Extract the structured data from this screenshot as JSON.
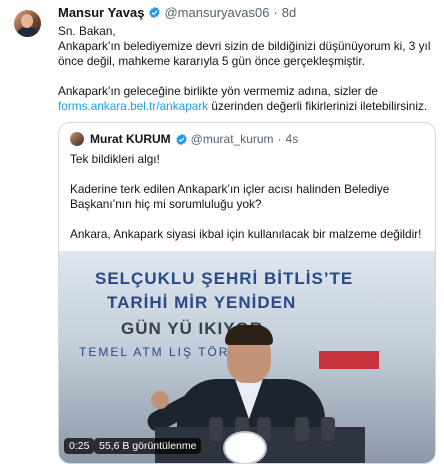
{
  "tweet": {
    "author_name": "Mansur Yavaş",
    "handle": "@mansuryavas06",
    "separator": "·",
    "time": "8d",
    "text": {
      "line1": "Sn. Bakan,",
      "line2": "Ankapark’ın belediyemize devri sizin de bildiğinizi düşünüyorum ki, 3 yıl önce değil, mahkeme kararıyla 5 gün önce gerçekleşmiştir.",
      "para2_before": "Ankapark’ın geleceğine birlikte yön vermemiz adına, sizler de ",
      "link": "forms.ankara.bel.tr/ankapark",
      "para2_after": " üzerinden değerli fikirlerinizi iletebilirsiniz."
    }
  },
  "quote": {
    "author_name": "Murat KURUM",
    "handle": "@murat_kurum",
    "separator": "·",
    "time": "4s",
    "text": {
      "line1": "Tek bildikleri algı!",
      "line2": "Kaderine terk edilen Ankapark’ın içler acısı halinden Belediye Başkanı’nın hiç mi sorumluluğu yok?",
      "line3": "Ankara, Ankapark siyasi ikbal için kullanılacak bir malzeme değildir!"
    },
    "video": {
      "duration": "0:25",
      "views": "55,6 B görüntülenme",
      "banner_line1": "SELÇUKLU ŞEHRİ BİTLİS’TE",
      "banner_line2": "TARİHİ MİR     YENİDEN",
      "banner_line3": "GÜN YÜ     IKIYOR",
      "banner_line4": "TEMEL ATM          LIŞ TÖRENİ"
    }
  },
  "colors": {
    "verified": "#1d9bf0",
    "link": "#1d9bf0",
    "muted": "#536471"
  }
}
